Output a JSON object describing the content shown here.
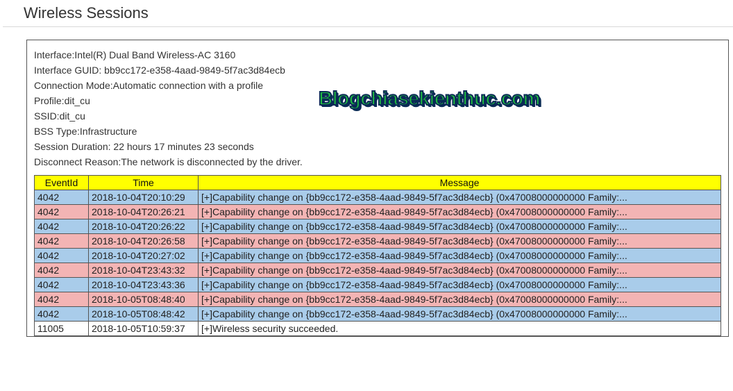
{
  "title": "Wireless Sessions",
  "watermark": "Blogchiasekienthuc.com",
  "meta": {
    "interface_label": "Interface:",
    "interface_value": "Intel(R) Dual Band Wireless-AC 3160",
    "guid_label": "Interface GUID: ",
    "guid_value": "bb9cc172-e358-4aad-9849-5f7ac3d84ecb",
    "conn_mode_label": "Connection Mode:",
    "conn_mode_value": "Automatic connection with a profile",
    "profile_label": "Profile:",
    "profile_value": "dit_cu",
    "ssid_label": "SSID:",
    "ssid_value": "dit_cu",
    "bss_label": "BSS Type:",
    "bss_value": "Infrastructure",
    "duration_label": "Session Duration: ",
    "duration_value": "22 hours 17 minutes 23 seconds",
    "disc_label": "Disconnect Reason:",
    "disc_value": "The network is disconnected by the driver."
  },
  "columns": {
    "eventid": "EventId",
    "time": "Time",
    "message": "Message"
  },
  "rows": [
    {
      "cls": "row-blue",
      "eventid": "4042",
      "time": "2018-10-04T20:10:29",
      "message": "[+]Capability change on {bb9cc172-e358-4aad-9849-5f7ac3d84ecb} (0x47008000000000 Family:..."
    },
    {
      "cls": "row-pink",
      "eventid": "4042",
      "time": "2018-10-04T20:26:21",
      "message": "[+]Capability change on {bb9cc172-e358-4aad-9849-5f7ac3d84ecb} (0x47008000000000 Family:..."
    },
    {
      "cls": "row-blue",
      "eventid": "4042",
      "time": "2018-10-04T20:26:22",
      "message": "[+]Capability change on {bb9cc172-e358-4aad-9849-5f7ac3d84ecb} (0x47008000000000 Family:..."
    },
    {
      "cls": "row-pink",
      "eventid": "4042",
      "time": "2018-10-04T20:26:58",
      "message": "[+]Capability change on {bb9cc172-e358-4aad-9849-5f7ac3d84ecb} (0x47008000000000 Family:..."
    },
    {
      "cls": "row-blue",
      "eventid": "4042",
      "time": "2018-10-04T20:27:02",
      "message": "[+]Capability change on {bb9cc172-e358-4aad-9849-5f7ac3d84ecb} (0x47008000000000 Family:..."
    },
    {
      "cls": "row-pink",
      "eventid": "4042",
      "time": "2018-10-04T23:43:32",
      "message": "[+]Capability change on {bb9cc172-e358-4aad-9849-5f7ac3d84ecb} (0x47008000000000 Family:..."
    },
    {
      "cls": "row-blue",
      "eventid": "4042",
      "time": "2018-10-04T23:43:36",
      "message": "[+]Capability change on {bb9cc172-e358-4aad-9849-5f7ac3d84ecb} (0x47008000000000 Family:..."
    },
    {
      "cls": "row-pink",
      "eventid": "4042",
      "time": "2018-10-05T08:48:40",
      "message": "[+]Capability change on {bb9cc172-e358-4aad-9849-5f7ac3d84ecb} (0x47008000000000 Family:..."
    },
    {
      "cls": "row-blue",
      "eventid": "4042",
      "time": "2018-10-05T08:48:42",
      "message": "[+]Capability change on {bb9cc172-e358-4aad-9849-5f7ac3d84ecb} (0x47008000000000 Family:..."
    },
    {
      "cls": "row-white",
      "eventid": "11005",
      "time": "2018-10-05T10:59:37",
      "message": "[+]Wireless security succeeded."
    }
  ]
}
